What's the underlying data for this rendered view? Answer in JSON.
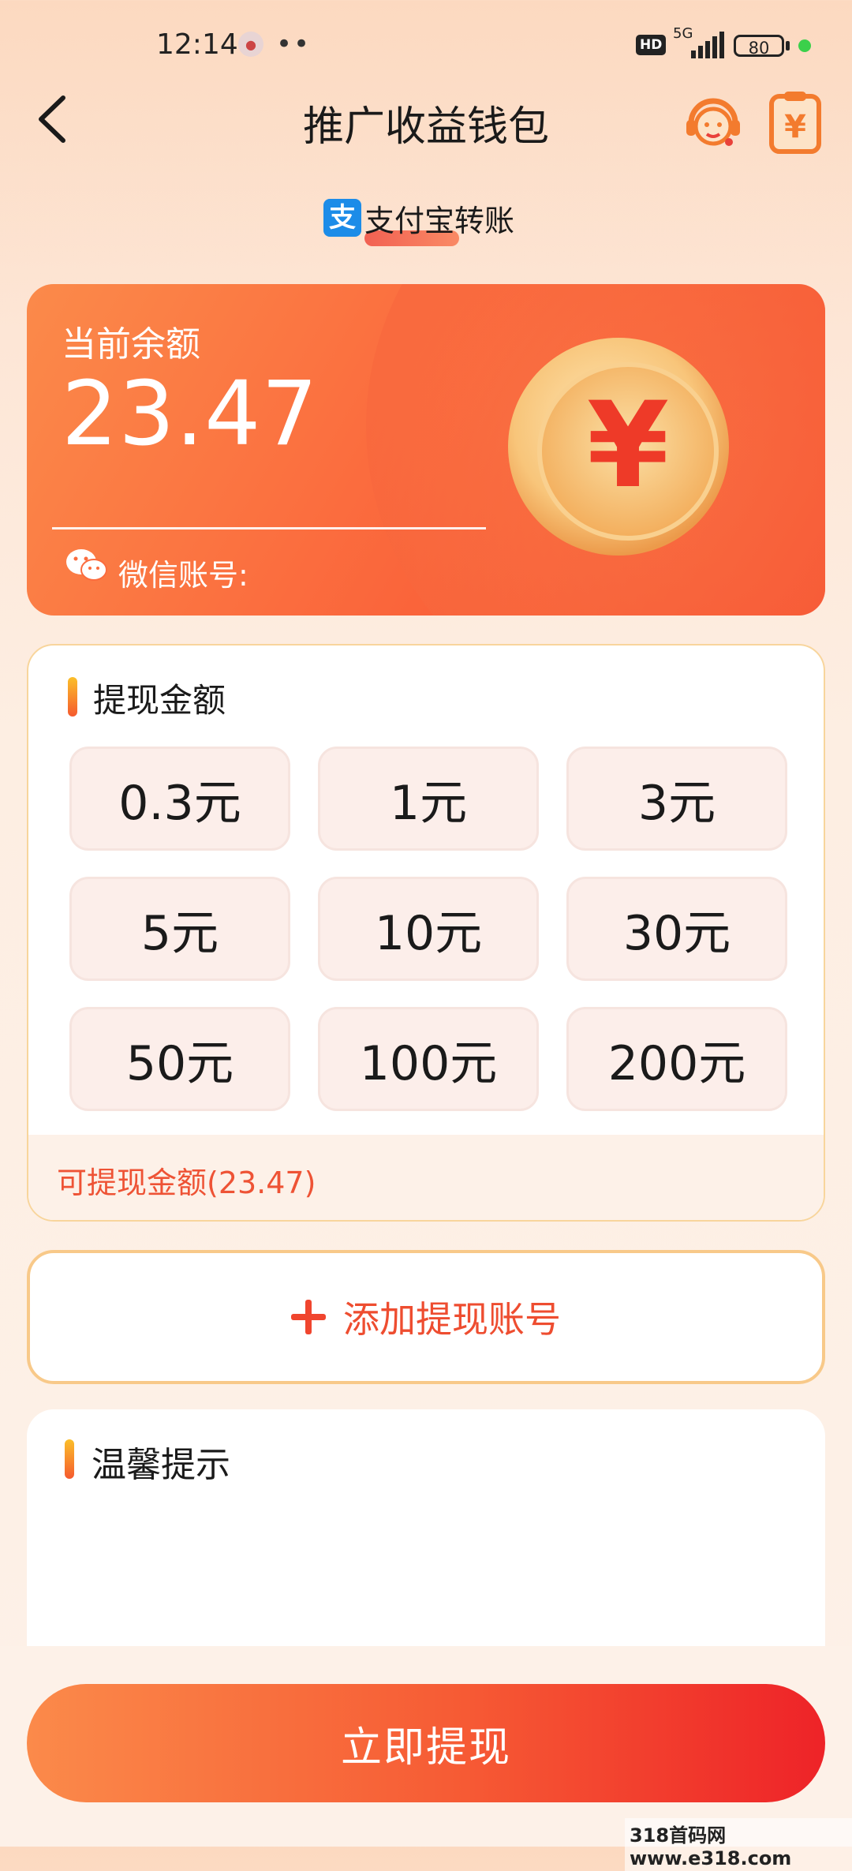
{
  "status_bar": {
    "time": "12:14",
    "more": "••",
    "hd": "HD",
    "network": "5G",
    "battery": "80"
  },
  "header": {
    "title": "推广收益钱包"
  },
  "tab": {
    "alipay_label": "支付宝转账",
    "alipay_logo": "支"
  },
  "balance": {
    "label": "当前余额",
    "value": "23.47",
    "wechat_label": "微信账号:",
    "coin_symbol": "¥"
  },
  "withdraw": {
    "heading": "提现金额",
    "amounts": [
      "0.3元",
      "1元",
      "3元",
      "5元",
      "10元",
      "30元",
      "50元",
      "100元",
      "200元"
    ],
    "available": "可提现金额(23.47)"
  },
  "add_account": {
    "label": "添加提现账号"
  },
  "tips": {
    "heading": "温馨提示"
  },
  "cta": {
    "label": "立即提现"
  },
  "watermark": "318首码网 www.e318.com",
  "colors": {
    "accent": "#ee4d30",
    "card_start": "#fb8a4a",
    "card_end": "#f64a2e",
    "chip_bg": "#fceeea",
    "border_gold": "#f8c989"
  },
  "icons": {
    "back": "chevron-left-icon",
    "service": "customer-service-icon",
    "bill": "yuan-bill-icon",
    "wechat": "wechat-icon",
    "coin": "yuan-coin-icon",
    "plus": "plus-icon"
  }
}
